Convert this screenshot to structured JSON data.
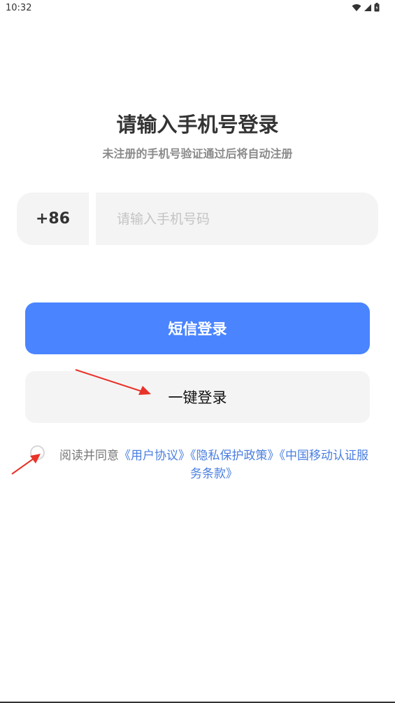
{
  "status_bar": {
    "time": "10:32",
    "icons": [
      "wifi-icon",
      "signal-icon",
      "battery-icon"
    ]
  },
  "header": {
    "title": "请输入手机号登录",
    "subtitle": "未注册的手机号验证通过后将自动注册"
  },
  "phone": {
    "country_code": "+86",
    "placeholder": "请输入手机号码",
    "value": ""
  },
  "buttons": {
    "sms_login": "短信登录",
    "one_key_login": "一键登录"
  },
  "agreement": {
    "checked": false,
    "prefix": "阅读并同意",
    "links": [
      "《用户协议》",
      "《隐私保护政策》",
      "《中国移动认证服务条款》"
    ]
  },
  "colors": {
    "primary": "#4a84ff",
    "link": "#4a7fe0",
    "annotation_arrow": "#e8332a"
  }
}
